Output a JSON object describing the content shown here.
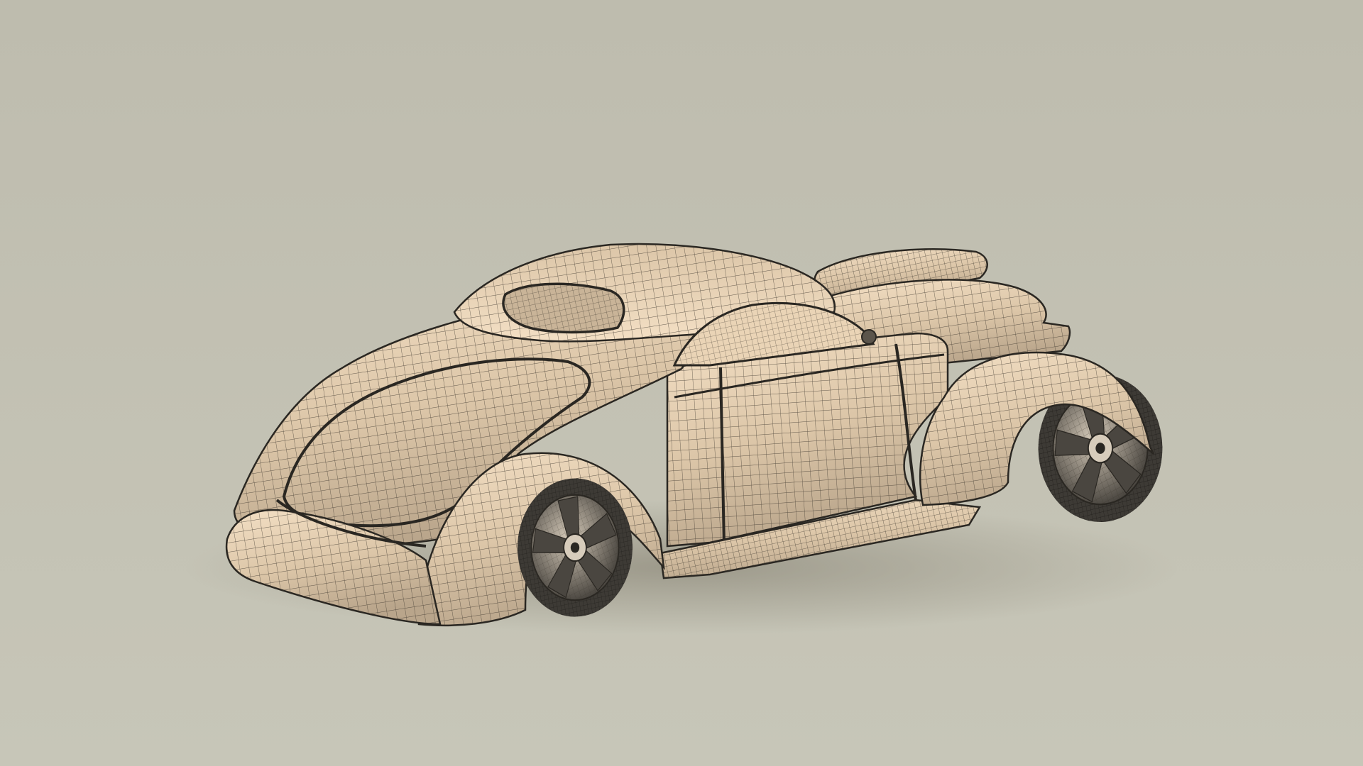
{
  "scene": {
    "subject": "car-wireframe-render",
    "colors": {
      "backdrop_top": "#bebcae",
      "backdrop_bottom": "#c7c6b8",
      "floor_shadow": "#8f8b7c",
      "body_light": "#f3dfc4",
      "body_mid": "#dcc6a8",
      "body_dark": "#b9a58b",
      "wire": "#3a342c",
      "tire": "#3d3a35",
      "rim": "#d7ccbb",
      "rim_dark": "#4a4640"
    },
    "parts": [
      "rear-deck",
      "roof",
      "rear-window",
      "side-window",
      "door",
      "rear-fender",
      "front-fender",
      "running-board",
      "hood-scoop",
      "rear-wheel",
      "front-wheel"
    ]
  }
}
